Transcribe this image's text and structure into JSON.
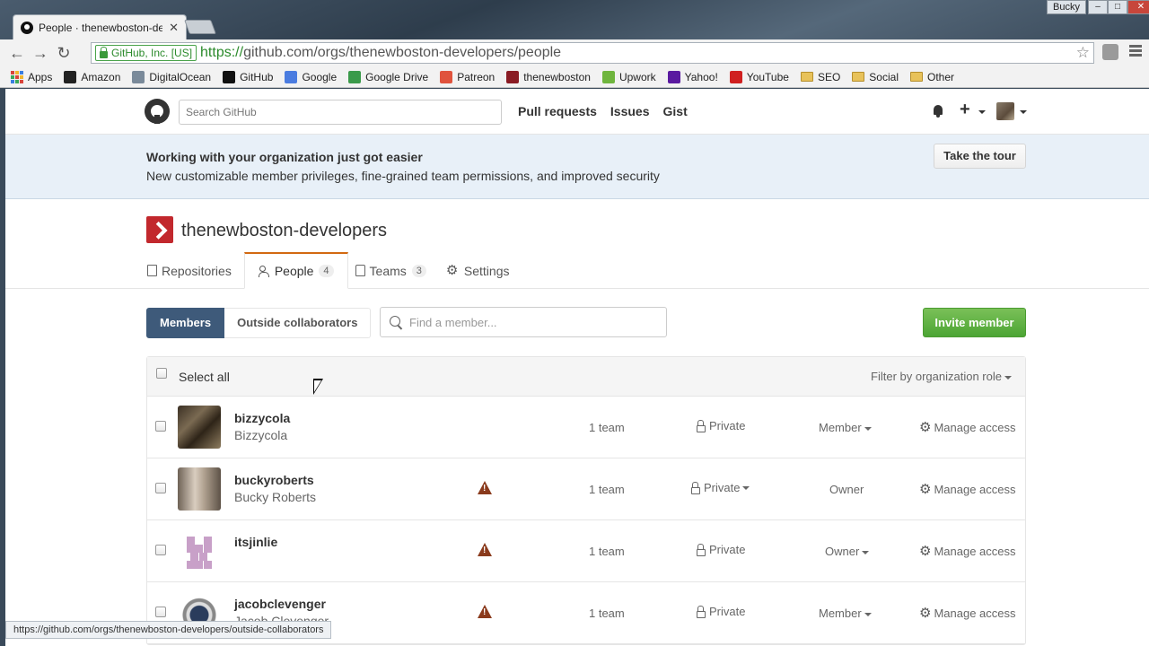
{
  "browser": {
    "tab_title": "People · thenewboston-de",
    "user_badge": "Bucky",
    "ev_label": "GitHub, Inc. [US]",
    "url_scheme": "https://",
    "url_host": "github.com",
    "url_path": "/orgs/thenewboston-developers/people",
    "bookmarks": [
      {
        "label": "Apps",
        "icon": "apps-icon"
      },
      {
        "label": "Amazon",
        "icon": "amazon-icon",
        "color": "#222222"
      },
      {
        "label": "DigitalOcean",
        "icon": "digitalocean-icon",
        "color": "#7a8a9a"
      },
      {
        "label": "GitHub",
        "icon": "github-icon",
        "color": "#111111"
      },
      {
        "label": "Google",
        "icon": "google-icon",
        "color": "#4a7ce0"
      },
      {
        "label": "Google Drive",
        "icon": "drive-icon",
        "color": "#3a9a4a"
      },
      {
        "label": "Patreon",
        "icon": "patreon-icon",
        "color": "#e0533d"
      },
      {
        "label": "thenewboston",
        "icon": "thenewboston-icon",
        "color": "#8a1c24"
      },
      {
        "label": "Upwork",
        "icon": "upwork-icon",
        "color": "#6fb53e"
      },
      {
        "label": "Yahoo!",
        "icon": "yahoo-icon",
        "color": "#5a1aa0"
      },
      {
        "label": "YouTube",
        "icon": "youtube-icon",
        "color": "#d02020"
      },
      {
        "label": "SEO",
        "icon": "folder-icon"
      },
      {
        "label": "Social",
        "icon": "folder-icon"
      },
      {
        "label": "Other",
        "icon": "folder-icon"
      }
    ],
    "status_url": "https://github.com/orgs/thenewboston-developers/outside-collaborators"
  },
  "header": {
    "search_placeholder": "Search GitHub",
    "nav": [
      "Pull requests",
      "Issues",
      "Gist"
    ],
    "plus": "+"
  },
  "banner": {
    "title": "Working with your organization just got easier",
    "subtitle": "New customizable member privileges, fine-grained team permissions, and improved security",
    "tour_label": "Take the tour"
  },
  "org": {
    "name": "thenewboston-developers",
    "tabs": [
      {
        "label": "Repositories",
        "count": "",
        "icon": "repo-icon"
      },
      {
        "label": "People",
        "count": "4",
        "icon": "people-icon"
      },
      {
        "label": "Teams",
        "count": "3",
        "icon": "jersey-icon"
      },
      {
        "label": "Settings",
        "count": "",
        "icon": "gear-icon"
      }
    ]
  },
  "members": {
    "subnav": [
      "Members",
      "Outside collaborators"
    ],
    "search_placeholder": "Find a member...",
    "invite_label": "Invite member",
    "select_all": "Select all",
    "filter_label": "Filter by organization role",
    "rows": [
      {
        "login": "bizzycola",
        "name": "Bizzycola",
        "warning": false,
        "teams": "1 team",
        "privacy": "Private",
        "privacy_menu": false,
        "role": "Member",
        "role_menu": true,
        "manage": "Manage access"
      },
      {
        "login": "buckyroberts",
        "name": "Bucky Roberts",
        "warning": true,
        "teams": "1 team",
        "privacy": "Private",
        "privacy_menu": true,
        "role": "Owner",
        "role_menu": false,
        "manage": "Manage access"
      },
      {
        "login": "itsjinlie",
        "name": "",
        "warning": true,
        "teams": "1 team",
        "privacy": "Private",
        "privacy_menu": false,
        "role": "Owner",
        "role_menu": true,
        "manage": "Manage access"
      },
      {
        "login": "jacobclevenger",
        "name": "Jacob Clevenger",
        "warning": true,
        "teams": "1 team",
        "privacy": "Private",
        "privacy_menu": false,
        "role": "Member",
        "role_menu": true,
        "manage": "Manage access"
      }
    ]
  },
  "colors": {
    "org_accent": "#c2282d",
    "tab_accent": "#d26911",
    "members_selected": "#3e5a7a",
    "invite_green": "#4ca534",
    "warning": "#8a3a1c"
  }
}
